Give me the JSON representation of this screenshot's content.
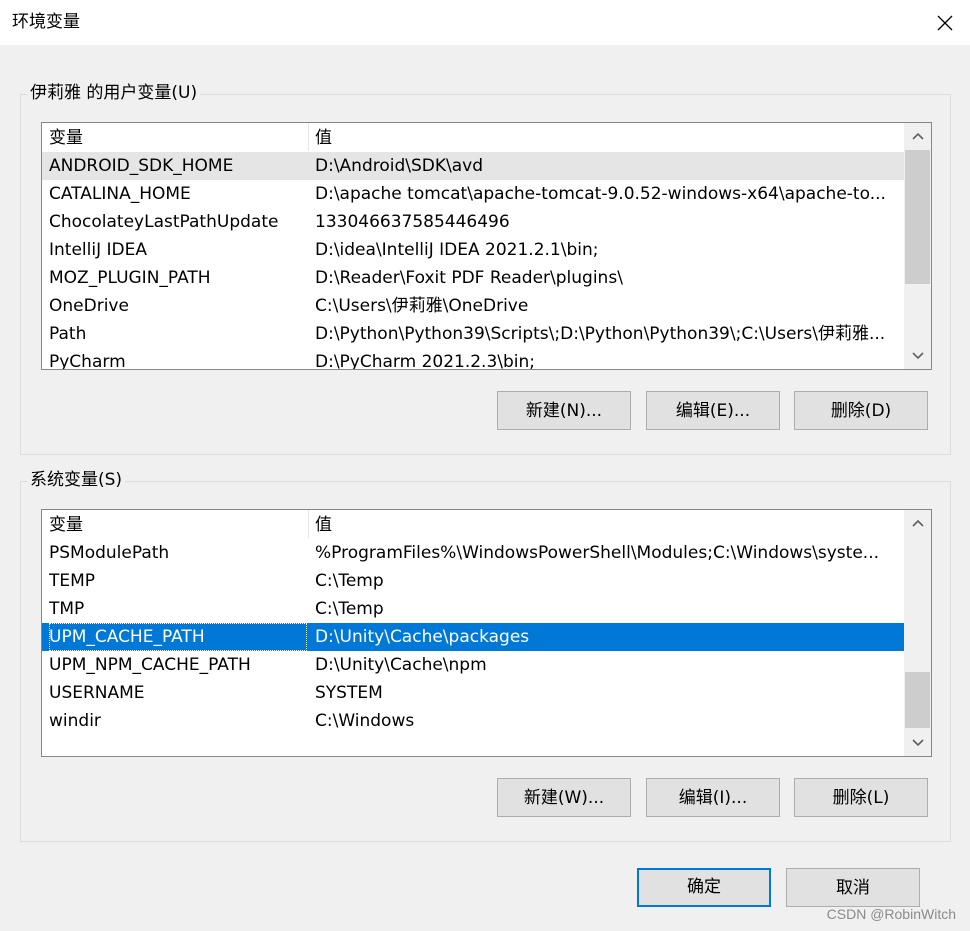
{
  "window": {
    "title": "环境变量"
  },
  "user_vars": {
    "legend": "伊莉雅 的用户变量(U)",
    "columns": {
      "name": "变量",
      "value": "值"
    },
    "rows": [
      {
        "name": "ANDROID_SDK_HOME",
        "value": "D:\\Android\\SDK\\avd",
        "state": "hover"
      },
      {
        "name": "CATALINA_HOME",
        "value": "D:\\apache tomcat\\apache-tomcat-9.0.52-windows-x64\\apache-to..."
      },
      {
        "name": "ChocolateyLastPathUpdate",
        "value": "133046637585446496"
      },
      {
        "name": "IntelliJ IDEA",
        "value": "D:\\idea\\IntelliJ IDEA 2021.2.1\\bin;"
      },
      {
        "name": "MOZ_PLUGIN_PATH",
        "value": "D:\\Reader\\Foxit PDF Reader\\plugins\\"
      },
      {
        "name": "OneDrive",
        "value": "C:\\Users\\伊莉雅\\OneDrive"
      },
      {
        "name": "Path",
        "value": "D:\\Python\\Python39\\Scripts\\;D:\\Python\\Python39\\;C:\\Users\\伊莉雅..."
      },
      {
        "name": "PyCharm",
        "value": "D:\\PyCharm 2021.2.3\\bin;"
      }
    ],
    "buttons": {
      "new": "新建(N)...",
      "edit": "编辑(E)...",
      "delete": "删除(D)"
    }
  },
  "system_vars": {
    "legend": "系统变量(S)",
    "columns": {
      "name": "变量",
      "value": "值"
    },
    "rows": [
      {
        "name": "PSModulePath",
        "value": "%ProgramFiles%\\WindowsPowerShell\\Modules;C:\\Windows\\syste..."
      },
      {
        "name": "TEMP",
        "value": "C:\\Temp"
      },
      {
        "name": "TMP",
        "value": "C:\\Temp"
      },
      {
        "name": "UPM_CACHE_PATH",
        "value": "D:\\Unity\\Cache\\packages",
        "state": "selected"
      },
      {
        "name": "UPM_NPM_CACHE_PATH",
        "value": "D:\\Unity\\Cache\\npm"
      },
      {
        "name": "USERNAME",
        "value": "SYSTEM"
      },
      {
        "name": "windir",
        "value": "C:\\Windows"
      }
    ],
    "buttons": {
      "new": "新建(W)...",
      "edit": "编辑(I)...",
      "delete": "删除(L)"
    }
  },
  "footer": {
    "ok": "确定",
    "cancel": "取消"
  },
  "watermark": "CSDN @RobinWitch",
  "colors": {
    "accent": "#0078d7",
    "hover_row": "#e5e5e5",
    "background": "#f0f0f0"
  },
  "icons": {
    "close": "close-icon",
    "scroll_up": "chevron-up-icon",
    "scroll_down": "chevron-down-icon"
  }
}
